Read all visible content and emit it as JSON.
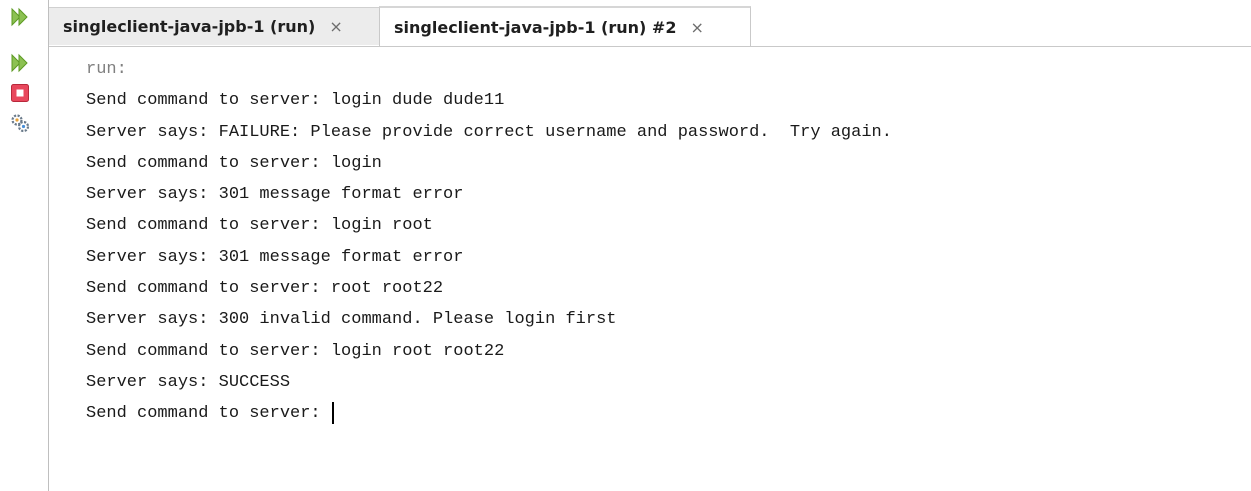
{
  "tabs": [
    {
      "label": "singleclient-java-jpb-1 (run)",
      "close": "×",
      "active": false
    },
    {
      "label": "singleclient-java-jpb-1 (run) #2",
      "close": "×",
      "active": true
    }
  ],
  "toolbar": {
    "buttons": [
      {
        "name": "rerun-icon",
        "color": "#7fbf3a"
      },
      {
        "name": "rerun-debug-icon",
        "color": "#7fbf3a"
      },
      {
        "name": "stop-icon",
        "color": "#e23b52"
      },
      {
        "name": "settings-icon",
        "color": "#5f6f7f"
      }
    ]
  },
  "console": {
    "lines": [
      "run:",
      "Send command to server: login dude dude11",
      "Server says: FAILURE: Please provide correct username and password.  Try again.",
      "Send command to server: login",
      "Server says: 301 message format error",
      "Send command to server: login root",
      "Server says: 301 message format error",
      "Send command to server: root root22",
      "Server says: 300 invalid command. Please login first",
      "Send command to server: login root root22",
      "Server says: SUCCESS",
      "Send command to server: "
    ]
  }
}
